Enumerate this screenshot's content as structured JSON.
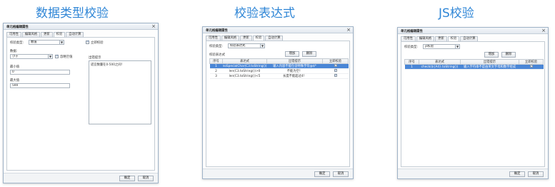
{
  "headings": [
    "数据类型校验",
    "校验表达式",
    "JS校验"
  ],
  "dialog_title": "单元格编辑属性",
  "close_glyph": "×",
  "tabs": [
    "可用性",
    "编辑风格",
    "更新",
    "校验",
    "自动计算"
  ],
  "buttons": {
    "ok": "确定",
    "cancel": "取消",
    "add": "增加",
    "delete": "删除"
  },
  "d1": {
    "type_label": "校验类型:",
    "type_value": "数值",
    "instant_label": "立即校验",
    "data_label": "数据:",
    "data_value": "小于",
    "allow_empty_label": "忽略空值",
    "min_label": "最小值",
    "min_value": "0",
    "max_label": "最大值",
    "max_value": "500",
    "tip_label": "出错提示",
    "tip_value": "适宜数量在0-500之间！"
  },
  "d2": {
    "type_label": "校验类型:",
    "type_value": "校验表达式",
    "expr_label": "校验表达式",
    "columns": [
      "序号",
      "表达式",
      "出错提示",
      "立即校验"
    ],
    "rows": [
      {
        "no": "1",
        "expr": "noSpecialChar(C3.toString())",
        "tip": "输入内容不能包含特殊字符@$*"
      },
      {
        "no": "2",
        "expr": "len(C3.toString())>0",
        "tip": "不能为空！"
      },
      {
        "no": "3",
        "expr": "len(C3.toString())<5",
        "tip": "长度不能超过4！"
      }
    ]
  },
  "d3": {
    "type_label": "校验类型:",
    "type_value": "js校验",
    "columns": [
      "序号",
      "表达式",
      "出错提示",
      "立即校验"
    ],
    "rows": [
      {
        "no": "1",
        "expr": "check(${A4}.toString())",
        "tip": "输入字符串不是由英文字母和数字组成"
      }
    ]
  }
}
